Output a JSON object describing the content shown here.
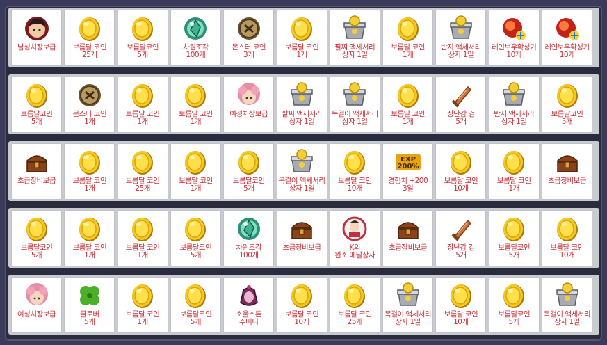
{
  "rows": [
    [
      {
        "label": "남성치장보급",
        "icon": "male-costume-icon"
      },
      {
        "label": "보름달 코인\n25개",
        "icon": "moon-coin-icon"
      },
      {
        "label": "보름달코인\n5개",
        "icon": "moon-coin-icon"
      },
      {
        "label": "차원조각\n100개",
        "icon": "dimension-shard-icon"
      },
      {
        "label": "몬스터 코인\n3개",
        "icon": "monster-coin-icon"
      },
      {
        "label": "보름달 코인\n1개",
        "icon": "moon-coin-icon"
      },
      {
        "label": "팔찌 액세서리\n상자 1일",
        "icon": "accessory-box-icon"
      },
      {
        "label": "보름달 코인\n1개",
        "icon": "moon-coin-icon"
      },
      {
        "label": "반지 액세서리\n상자 1일",
        "icon": "accessory-box-icon"
      },
      {
        "label": "레인보우확성기\n10개",
        "icon": "rainbow-megaphone-icon"
      },
      {
        "label": "레인보우확성기\n10개",
        "icon": "rainbow-megaphone-icon"
      }
    ],
    [
      {
        "label": "보름달코인\n5개",
        "icon": "moon-coin-icon"
      },
      {
        "label": "몬스터 코인\n1개",
        "icon": "monster-coin-icon"
      },
      {
        "label": "보름달 코인\n1개",
        "icon": "moon-coin-icon"
      },
      {
        "label": "보름달 코인\n1개",
        "icon": "moon-coin-icon"
      },
      {
        "label": "여성치장보급",
        "icon": "female-costume-icon"
      },
      {
        "label": "팔찌 액세서리\n상자 1일",
        "icon": "accessory-box-icon"
      },
      {
        "label": "목걸이 액세서리\n상자 1일",
        "icon": "accessory-box-icon"
      },
      {
        "label": "보름달 코인\n1개",
        "icon": "moon-coin-icon"
      },
      {
        "label": "장난감 검\n5개",
        "icon": "toy-sword-icon"
      },
      {
        "label": "반지 액세서리\n상자 1일",
        "icon": "accessory-box-icon"
      },
      {
        "label": "보름달코인\n5개",
        "icon": "moon-coin-icon"
      }
    ],
    [
      {
        "label": "초급장비보급",
        "icon": "equipment-chest-icon"
      },
      {
        "label": "보름달 코인\n1개",
        "icon": "moon-coin-icon"
      },
      {
        "label": "보름달 코인\n25개",
        "icon": "moon-coin-icon"
      },
      {
        "label": "보름달 코인\n1개",
        "icon": "moon-coin-icon"
      },
      {
        "label": "보름달코인\n5개",
        "icon": "moon-coin-icon"
      },
      {
        "label": "목걸이 액세서리\n상자 1일",
        "icon": "accessory-box-icon"
      },
      {
        "label": "보름달 코인\n10개",
        "icon": "moon-coin-icon"
      },
      {
        "label": "경험치 +200\n3일",
        "icon": "exp-boost-icon"
      },
      {
        "label": "보름달 코인\n10개",
        "icon": "moon-coin-icon"
      },
      {
        "label": "보름달 코인\n1개",
        "icon": "moon-coin-icon"
      },
      {
        "label": "초급장비보급",
        "icon": "equipment-chest-icon"
      }
    ],
    [
      {
        "label": "보름달코인\n5개",
        "icon": "moon-coin-icon"
      },
      {
        "label": "보름달 코인\n1개",
        "icon": "moon-coin-icon"
      },
      {
        "label": "보름달 코인\n1개",
        "icon": "moon-coin-icon"
      },
      {
        "label": "보름달코인\n5개",
        "icon": "moon-coin-icon"
      },
      {
        "label": "차원조각\n100개",
        "icon": "dimension-shard-icon"
      },
      {
        "label": "초급장비보급",
        "icon": "equipment-chest-icon"
      },
      {
        "label": "K의\n완소 메달상자",
        "icon": "medal-box-icon"
      },
      {
        "label": "초급장비보급",
        "icon": "equipment-chest-icon"
      },
      {
        "label": "장난감 검\n5개",
        "icon": "toy-sword-icon"
      },
      {
        "label": "보름달코인\n5개",
        "icon": "moon-coin-icon"
      },
      {
        "label": "보름달 코인\n10개",
        "icon": "moon-coin-icon"
      }
    ],
    [
      {
        "label": "여성치장보급",
        "icon": "female-costume-icon"
      },
      {
        "label": "클로버\n5개",
        "icon": "clover-icon"
      },
      {
        "label": "보름달 코인\n1개",
        "icon": "moon-coin-icon"
      },
      {
        "label": "보름달코인\n5개",
        "icon": "moon-coin-icon"
      },
      {
        "label": "소울스톤\n주머니",
        "icon": "soulstone-pouch-icon"
      },
      {
        "label": "보름달 코인\n10개",
        "icon": "moon-coin-icon"
      },
      {
        "label": "보름달 코인\n25개",
        "icon": "moon-coin-icon"
      },
      {
        "label": "목걸이 액세서리\n상자 1일",
        "icon": "accessory-box-icon"
      },
      {
        "label": "보름달 코인\n10개",
        "icon": "moon-coin-icon"
      },
      {
        "label": "보름달코인\n5개",
        "icon": "moon-coin-icon"
      },
      {
        "label": "목걸이 액세서리\n상자 1일",
        "icon": "accessory-box-icon"
      }
    ]
  ],
  "exp_badge": {
    "line1": "EXP",
    "line2": "200%"
  },
  "colors": {
    "label": "#c8323a",
    "coin": "#f2c21a",
    "background": "#2a2c3e"
  }
}
